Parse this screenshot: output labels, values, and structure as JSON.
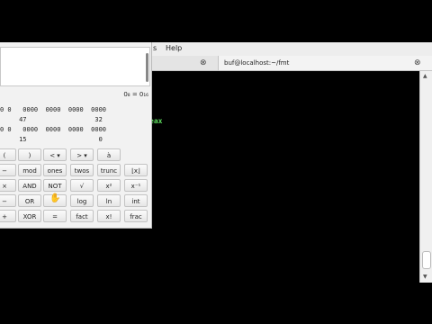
{
  "terminal": {
    "menu": {
      "help_label": "Help",
      "partial_menu": "s"
    },
    "tabs": [
      {
        "title": "",
        "close": "⊗"
      },
      {
        "title": "buf@localhost:~/fmt",
        "close": "⊗"
      }
    ],
    "visible_text": "eax"
  },
  "calculator": {
    "base_label": "0₈ = 0₁₆",
    "bit_rows": [
      {
        "bits": "0 0   0000  0000  0000  0000",
        "labels": "     47                  32"
      },
      {
        "bits": "0 0   0000  0000  0000  0000",
        "labels": "     15                   0"
      }
    ],
    "buttons": [
      [
        "(",
        ")",
        "< ▾",
        "> ▾",
        "à"
      ],
      [
        "−",
        "mod",
        "ones",
        "twos",
        "trunc",
        "⌊x⌋"
      ],
      [
        "×",
        "AND",
        "NOT",
        "√",
        "x²",
        "x⁻¹"
      ],
      [
        "−",
        "OR",
        "",
        "log",
        "ln",
        "int"
      ],
      [
        "+",
        "XOR",
        "=",
        "fact",
        "x!",
        "frac"
      ]
    ]
  }
}
